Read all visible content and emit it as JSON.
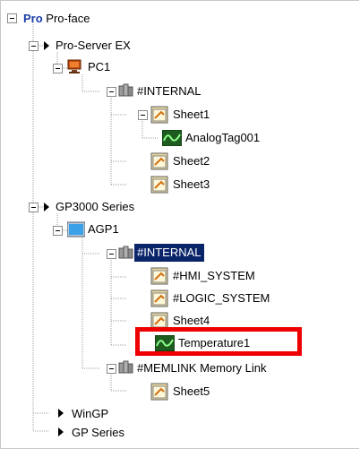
{
  "tree": {
    "root": {
      "badge": "Pro",
      "label": "Pro-face"
    },
    "pro_server": {
      "label": "Pro-Server EX"
    },
    "pc1": {
      "label": "PC1"
    },
    "pc1_internal": {
      "label": "#INTERNAL"
    },
    "sheet1": {
      "label": "Sheet1"
    },
    "analogtag": {
      "label": "AnalogTag001"
    },
    "sheet2": {
      "label": "Sheet2"
    },
    "sheet3": {
      "label": "Sheet3"
    },
    "gp3000": {
      "label": "GP3000 Series"
    },
    "agp1": {
      "label": "AGP1"
    },
    "agp1_internal": {
      "label": "#INTERNAL"
    },
    "hmi_system": {
      "label": "#HMI_SYSTEM"
    },
    "logic_system": {
      "label": "#LOGIC_SYSTEM"
    },
    "sheet4": {
      "label": "Sheet4"
    },
    "temperature1": {
      "label": "Temperature1"
    },
    "memlink": {
      "label": "#MEMLINK Memory Link"
    },
    "sheet5": {
      "label": "Sheet5"
    },
    "wingp": {
      "label": "WinGP"
    },
    "gp_series": {
      "label": "GP Series"
    }
  },
  "colors": {
    "selection": "#0a246a",
    "highlight_box": "#ee0000"
  },
  "icons": [
    "expander-minus-icon",
    "arrow-right-icon",
    "pc-icon",
    "tag-folder-icon",
    "sheet-icon",
    "analog-tag-icon",
    "display-icon"
  ]
}
